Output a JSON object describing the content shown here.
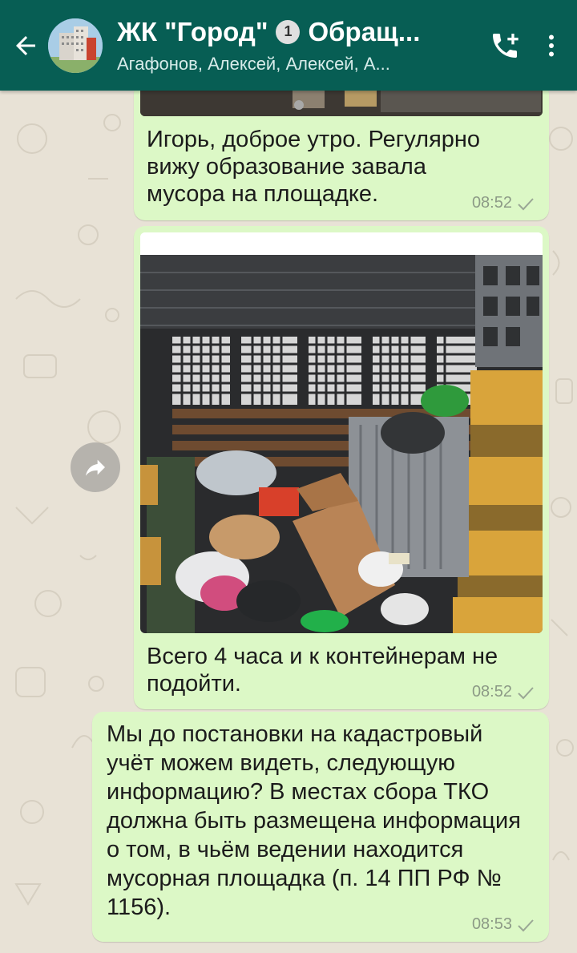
{
  "header": {
    "title_prefix": "ЖК \"Город\"",
    "pin_number": "1",
    "title_suffix": "Обращ...",
    "members": "Агафонов, Алексей, Алексей, А..."
  },
  "messages": [
    {
      "text": "Игорь, доброе утро. Регулярно вижу образование завала мусора на площадке.",
      "time": "08:52"
    },
    {
      "image": "photo-overflowing-garbage-containers",
      "caption": "Всего 4 часа и к контейнерам не подойти.",
      "time": "08:52"
    },
    {
      "text": "Мы до постановки на кадастровый учёт можем видеть, следующую информацию? В местах сбора ТКО должна быть размещена информация о том, в чьём ведении находится мусорная площадка (п. 14 ПП РФ № 1156).",
      "time": "08:53"
    }
  ],
  "colors": {
    "header": "#075e54",
    "outgoing_bubble": "#dcf8c6",
    "chat_background": "#e8e2d6"
  }
}
